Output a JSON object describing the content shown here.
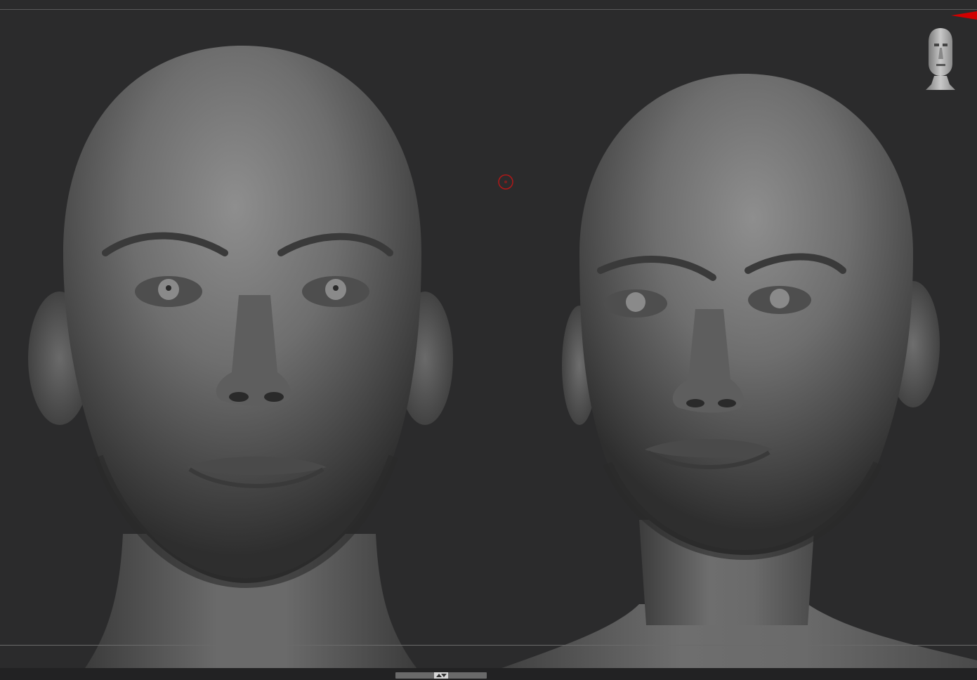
{
  "app": {
    "canvas": {
      "background": "#2b2b2c",
      "border_color": "#5a5a5a"
    },
    "navigation_gizmo": {
      "icon": "head-navigation-icon"
    },
    "indicators": {
      "red_arrow_color": "#d10000",
      "brush_cursor_color": "#b01818"
    },
    "models": [
      {
        "name": "female-head-sculpt-front",
        "view": "front"
      },
      {
        "name": "female-head-sculpt-three-quarter",
        "view": "three-quarter"
      }
    ]
  }
}
